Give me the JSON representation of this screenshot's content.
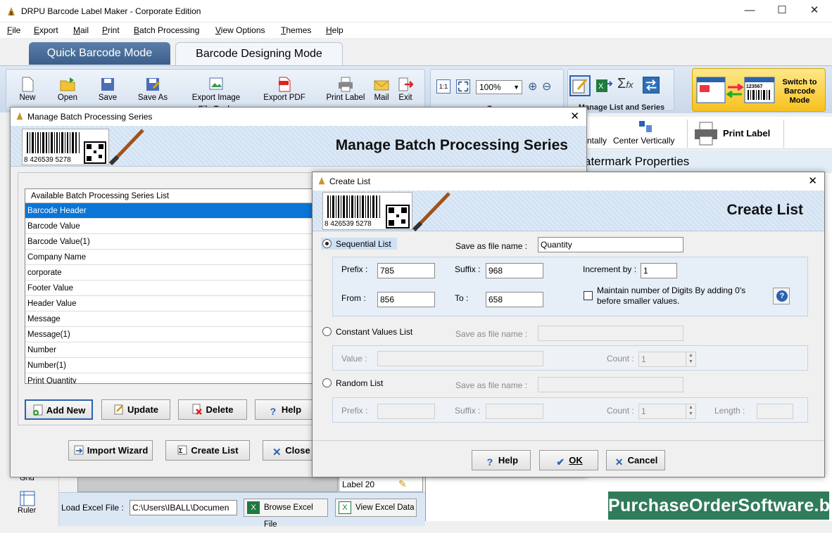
{
  "window": {
    "title": "DRPU Barcode Label Maker - Corporate Edition",
    "minimize": "—",
    "maximize": "☐",
    "close": "✕"
  },
  "menu": [
    "File",
    "Export",
    "Mail",
    "Print",
    "Batch Processing",
    "View Options",
    "Themes",
    "Help"
  ],
  "mode_tabs": {
    "quick": "Quick Barcode Mode",
    "designing": "Barcode Designing Mode"
  },
  "ribbon": {
    "file_tools": [
      "New",
      "Open",
      "Save",
      "Save As",
      "Export Image",
      "Export PDF",
      "Print Label",
      "Mail",
      "Exit"
    ],
    "file_tools_label": "File Tools",
    "zoom_label": "Zoom",
    "zoom_value": "100%",
    "zoom_fit": "1:1",
    "manage_label": "Manage List and Series",
    "switch_label": "Switch to Barcode Mode",
    "switch_sample": "123567"
  },
  "background": {
    "center_h": "ntally",
    "center_v": "Center Vertically",
    "print_label": "Print Label",
    "watermark_props": "atermark Properties",
    "grid": "Grid",
    "ruler": "Ruler",
    "label20": "Label 20",
    "load_excel": "Load Excel File :",
    "excel_path": "C:\\Users\\IBALL\\Documen",
    "browse_excel": "Browse Excel File",
    "view_excel": "View Excel Data"
  },
  "dialog1": {
    "title": "Manage Batch Processing Series",
    "banner": "Manage Batch Processing Series",
    "barcode_number": "8 426539 5278",
    "list_header": "Available Batch Processing Series List",
    "items": [
      "Barcode Header",
      "Barcode Value",
      "Barcode Value(1)",
      "Company Name",
      "corporate",
      "Footer Value",
      "Header Value",
      "Message",
      "Message(1)",
      "Number",
      "Number(1)",
      "Print Quantity"
    ],
    "buttons": {
      "add_new": "Add New",
      "update": "Update",
      "delete": "Delete",
      "help": "Help",
      "import_wizard": "Import Wizard",
      "create_list": "Create List",
      "close": "Close"
    }
  },
  "dialog2": {
    "title": "Create List",
    "banner": "Create List",
    "barcode_number": "8 426539 5278",
    "sequential": {
      "label": "Sequential List",
      "save_as_label": "Save as file name :",
      "save_as_value": "Quantity",
      "prefix_label": "Prefix :",
      "prefix": "785",
      "suffix_label": "Suffix :",
      "suffix": "968",
      "increment_label": "Increment by :",
      "increment": "1",
      "from_label": "From :",
      "from": "856",
      "to_label": "To :",
      "to": "658",
      "maintain_label": "Maintain number of Digits By adding 0's before smaller values."
    },
    "constant": {
      "label": "Constant Values List",
      "save_as_label": "Save as file name :",
      "value_label": "Value :",
      "count_label": "Count :",
      "count": "1"
    },
    "random": {
      "label": "Random List",
      "save_as_label": "Save as file name :",
      "prefix_label": "Prefix :",
      "suffix_label": "Suffix :",
      "count_label": "Count :",
      "count": "1",
      "length_label": "Length :"
    },
    "buttons": {
      "help": "Help",
      "ok": "OK",
      "cancel": "Cancel"
    }
  },
  "site_watermark": "PurchaseOrderSoftware.biz"
}
